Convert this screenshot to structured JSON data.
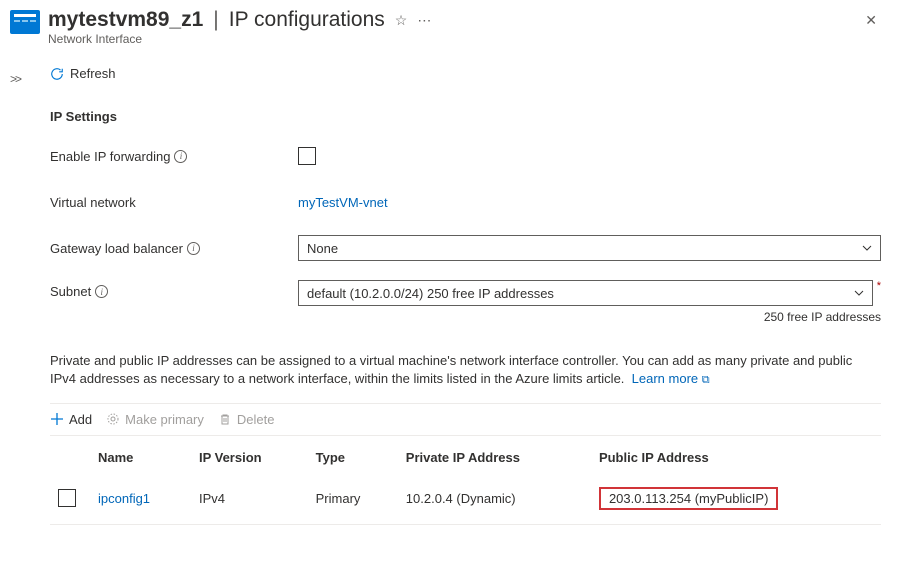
{
  "header": {
    "resourceName": "mytestvm89_z1",
    "pageTitle": "IP configurations",
    "resourceType": "Network Interface"
  },
  "commands": {
    "refresh": "Refresh"
  },
  "sections": {
    "ipSettingsHeading": "IP Settings",
    "labels": {
      "enableIpForwarding": "Enable IP forwarding",
      "virtualNetwork": "Virtual network",
      "gatewayLoadBalancer": "Gateway load balancer",
      "subnet": "Subnet"
    },
    "values": {
      "virtualNetwork": "myTestVM-vnet",
      "gatewayLoadBalancer": "None",
      "subnet": "default (10.2.0.0/24) 250 free IP addresses",
      "subnetHint": "250 free IP addresses"
    }
  },
  "description": {
    "text": "Private and public IP addresses can be assigned to a virtual machine's network interface controller. You can add as many private and public IPv4 addresses as necessary to a network interface, within the limits listed in the Azure limits article.",
    "learnMore": "Learn more"
  },
  "actions": {
    "add": "Add",
    "makePrimary": "Make primary",
    "delete": "Delete"
  },
  "table": {
    "headers": {
      "name": "Name",
      "ipVersion": "IP Version",
      "type": "Type",
      "privateIp": "Private IP Address",
      "publicIp": "Public IP Address"
    },
    "rows": [
      {
        "name": "ipconfig1",
        "ipVersion": "IPv4",
        "type": "Primary",
        "privateIp": "10.2.0.4 (Dynamic)",
        "publicIp": "203.0.113.254 (myPublicIP)"
      }
    ]
  }
}
